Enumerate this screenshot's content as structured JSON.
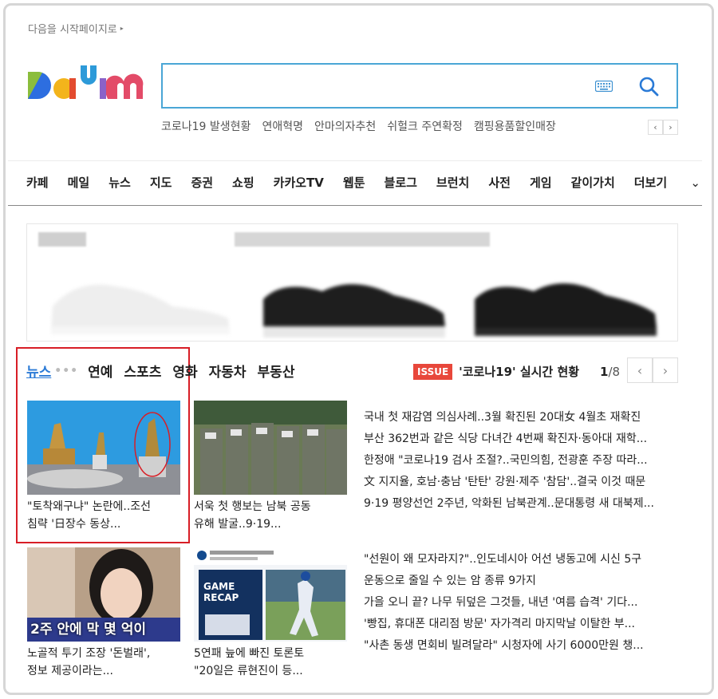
{
  "top": {
    "start_page_link": "다음을 시작페이지로"
  },
  "search": {
    "placeholder": ""
  },
  "rank_keywords": [
    "코로나19 발생현황",
    "연애혁명",
    "안마의자추천",
    "쉬헐크 주연확정",
    "캠핑용품할인매장"
  ],
  "gnb": [
    "카페",
    "메일",
    "뉴스",
    "지도",
    "증권",
    "쇼핑",
    "카카오TV",
    "웹툰",
    "블로그",
    "브런치",
    "사전",
    "게임",
    "같이가치",
    "더보기"
  ],
  "news_tabs": {
    "active": "뉴스",
    "others": [
      "연예",
      "스포츠",
      "영화",
      "자동차",
      "부동산"
    ]
  },
  "issue": {
    "badge": "ISSUE",
    "text": "'코로나19' 실시간 현황"
  },
  "pager": {
    "current": "1",
    "total": "/8"
  },
  "cards": [
    {
      "line1": "\"토착왜구냐\" 논란에..조선",
      "line2": "침략 '日장수 동상..."
    },
    {
      "line1": "서욱 첫 행보는 남북 공동",
      "line2": "유해 발굴..9·19..."
    },
    {
      "line1": "노골적 투기 조장 '돈벌래',",
      "line2": "정보 제공이라는...",
      "overlay": "2주 안에 막 몇 억이"
    },
    {
      "line1": "5연패 늪에 빠진 토론토",
      "line2": "\"20일은 류현진이 등...",
      "overlay": "GAME RECAP"
    }
  ],
  "headlines_1": [
    "국내 첫 재감염 의심사례..3월 확진된 20대女 4월초 재확진",
    "부산 362번과 같은 식당 다녀간 4번째 확진자·동아대 재학...",
    "한정애 \"코로나19 검사 조절?..국민의힘, 전광훈 주장 따라...",
    "文 지지율, 호남·충남 '탄탄' 강원·제주 '참담'..결국 이것 때문",
    "9·19 평양선언 2주년, 악화된 남북관계..문대통령 새 대북제..."
  ],
  "headlines_2": [
    "\"선원이 왜 모자라지?\"..인도네시아 어선 냉동고에 시신 5구",
    "운동으로 줄일 수 있는 암 종류 9가지",
    "가을 오니 끝? 나무 뒤덮은 그것들, 내년 '여름 습격' 기다...",
    "'빵집, 휴대폰 대리점 방문' 자가격리 마지막날 이탈한 부...",
    "\"사촌 동생 면회비 빌려달라\" 시청자에 사기 6000만원 챙..."
  ]
}
